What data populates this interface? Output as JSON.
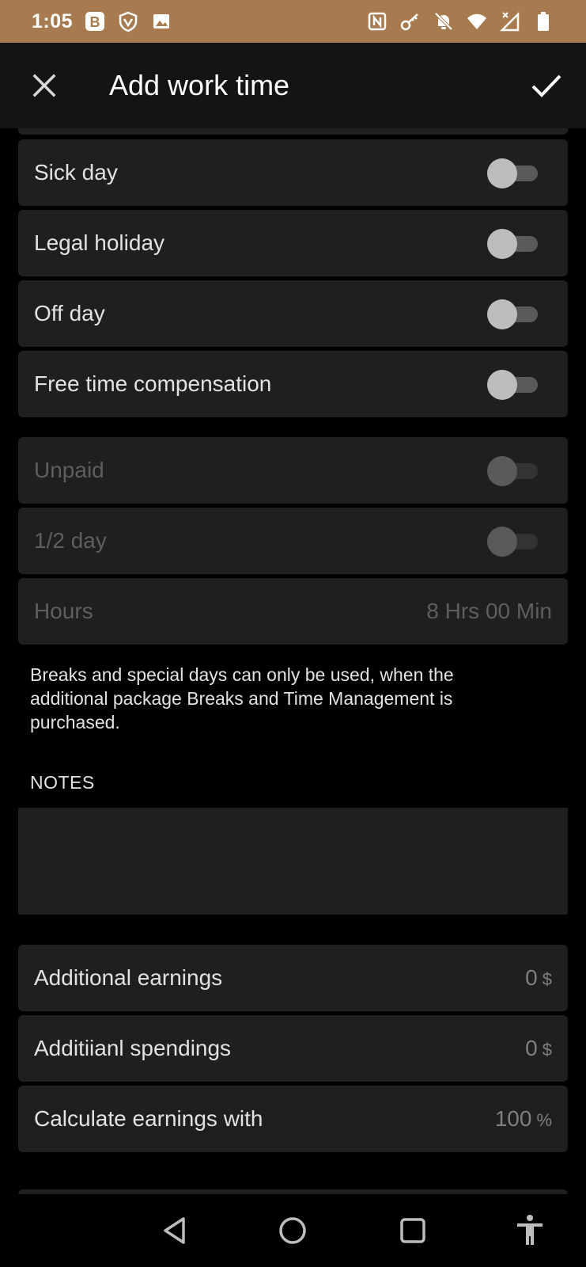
{
  "status_bar": {
    "time": "1:05",
    "icons": [
      "b-app-icon",
      "shield-icon",
      "image-icon",
      "nfc-icon",
      "key-icon",
      "bell-off-icon",
      "wifi-icon",
      "signal-icon",
      "battery-icon"
    ]
  },
  "app_bar": {
    "title": "Add work time",
    "close_icon": "close-icon",
    "confirm_icon": "check-icon"
  },
  "toggles": [
    {
      "label": "Sick day",
      "on": false,
      "enabled": true
    },
    {
      "label": "Legal holiday",
      "on": false,
      "enabled": true
    },
    {
      "label": "Off day",
      "on": false,
      "enabled": true
    },
    {
      "label": "Free time compensation",
      "on": false,
      "enabled": true
    },
    {
      "label": "Unpaid",
      "on": false,
      "enabled": false
    },
    {
      "label": "1/2 day",
      "on": false,
      "enabled": false
    }
  ],
  "hours": {
    "label": "Hours",
    "value": "8 Hrs 00 Min"
  },
  "info_text": "Breaks and special days can only be used, when the additional package Breaks and Time Management is purchased.",
  "notes": {
    "header": "NOTES",
    "value": ""
  },
  "money": [
    {
      "label": "Additional earnings",
      "value": "0",
      "unit": "$"
    },
    {
      "label": "Additiianl spendings",
      "value": "0",
      "unit": "$"
    },
    {
      "label": "Calculate earnings with",
      "value": "100",
      "unit": "%"
    }
  ],
  "nav": [
    "back-icon",
    "home-icon",
    "recents-icon",
    "accessibility-icon"
  ],
  "colors": {
    "status_bar": "#a77b4f",
    "app_bar": "#141414",
    "card": "#1f1f1f",
    "background": "#000000"
  }
}
